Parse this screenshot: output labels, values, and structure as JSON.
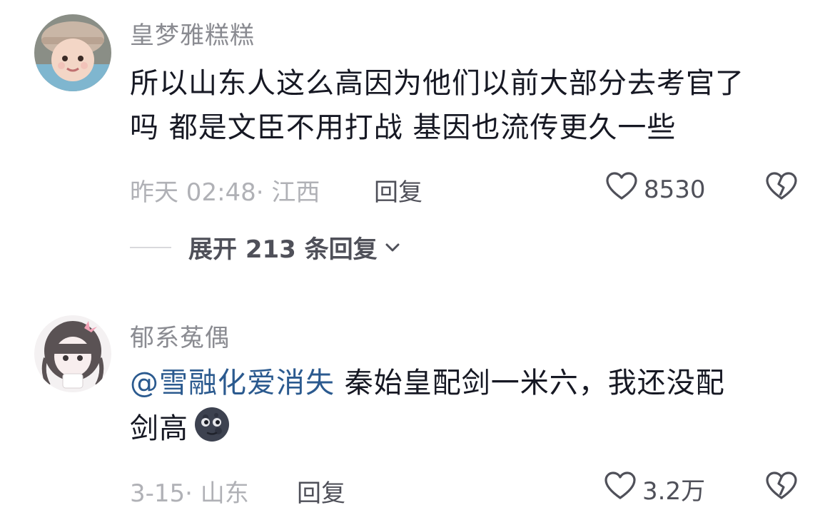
{
  "comments": [
    {
      "username": "皇梦雅糕糕",
      "text_line1": "所以山东人这么高因为他们以前大部分去考官了",
      "text_line2": "吗 都是文臣不用打战 基因也流传更久一些",
      "meta": "昨天 02:48· 江西",
      "reply_label": "回复",
      "like_count": "8530",
      "expand_label": "展开 213 条回复"
    },
    {
      "username": "郁系菟偶",
      "mention": "@雪融化爱消失",
      "text_line1_rest": " 秦始皇配剑一米六，我还没配",
      "text_line2": "剑高",
      "emoji": "new-moon-face",
      "meta": "3-15· 山东",
      "reply_label": "回复",
      "like_count": "3.2万"
    }
  ],
  "colors": {
    "text": "#161823",
    "username": "#8a8b91",
    "meta": "#b0b1b6",
    "mention": "#2b5a8f",
    "action": "#4f5059"
  }
}
